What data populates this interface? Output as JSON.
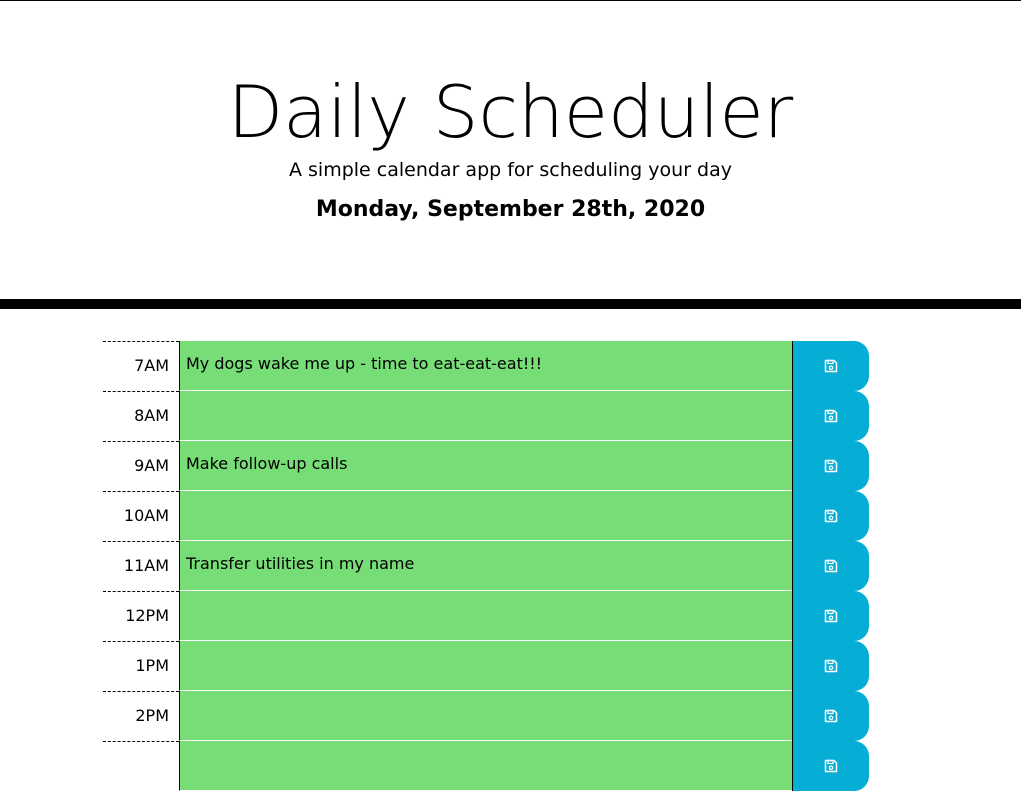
{
  "header": {
    "title": "Daily Scheduler",
    "subtitle": "A simple calendar app for scheduling your day",
    "current_day": "Monday, September 28th, 2020"
  },
  "colors": {
    "present": "#77dd77",
    "save_button": "#06aed5"
  },
  "time_blocks": [
    {
      "hour": "7AM",
      "text": "My dogs wake me up - time to eat-eat-eat!!!",
      "icon": "save-icon"
    },
    {
      "hour": "8AM",
      "text": "",
      "icon": "save-icon"
    },
    {
      "hour": "9AM",
      "text": "Make follow-up calls",
      "icon": "save-icon"
    },
    {
      "hour": "10AM",
      "text": "",
      "icon": "save-icon"
    },
    {
      "hour": "11AM",
      "text": "Transfer utilities in my name",
      "icon": "save-icon"
    },
    {
      "hour": "12PM",
      "text": "",
      "icon": "save-icon"
    },
    {
      "hour": "1PM",
      "text": "",
      "icon": "save-icon"
    },
    {
      "hour": "2PM",
      "text": "",
      "icon": "save-icon"
    },
    {
      "hour": "",
      "text": "",
      "icon": "save-icon"
    }
  ]
}
